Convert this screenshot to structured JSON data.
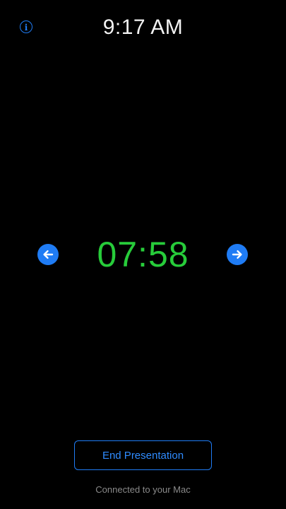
{
  "header": {
    "time": "9:17 AM",
    "info_icon": "info-icon"
  },
  "timer": {
    "value": "07:58",
    "prev_icon": "arrow-left-icon",
    "next_icon": "arrow-right-icon"
  },
  "footer": {
    "end_label": "End Presentation",
    "status": "Connected to your Mac"
  },
  "colors": {
    "background": "#000000",
    "accent": "#1f7cf5",
    "timer": "#27cc3a",
    "clock": "#f2f2f2",
    "status": "#8a8a8a"
  }
}
